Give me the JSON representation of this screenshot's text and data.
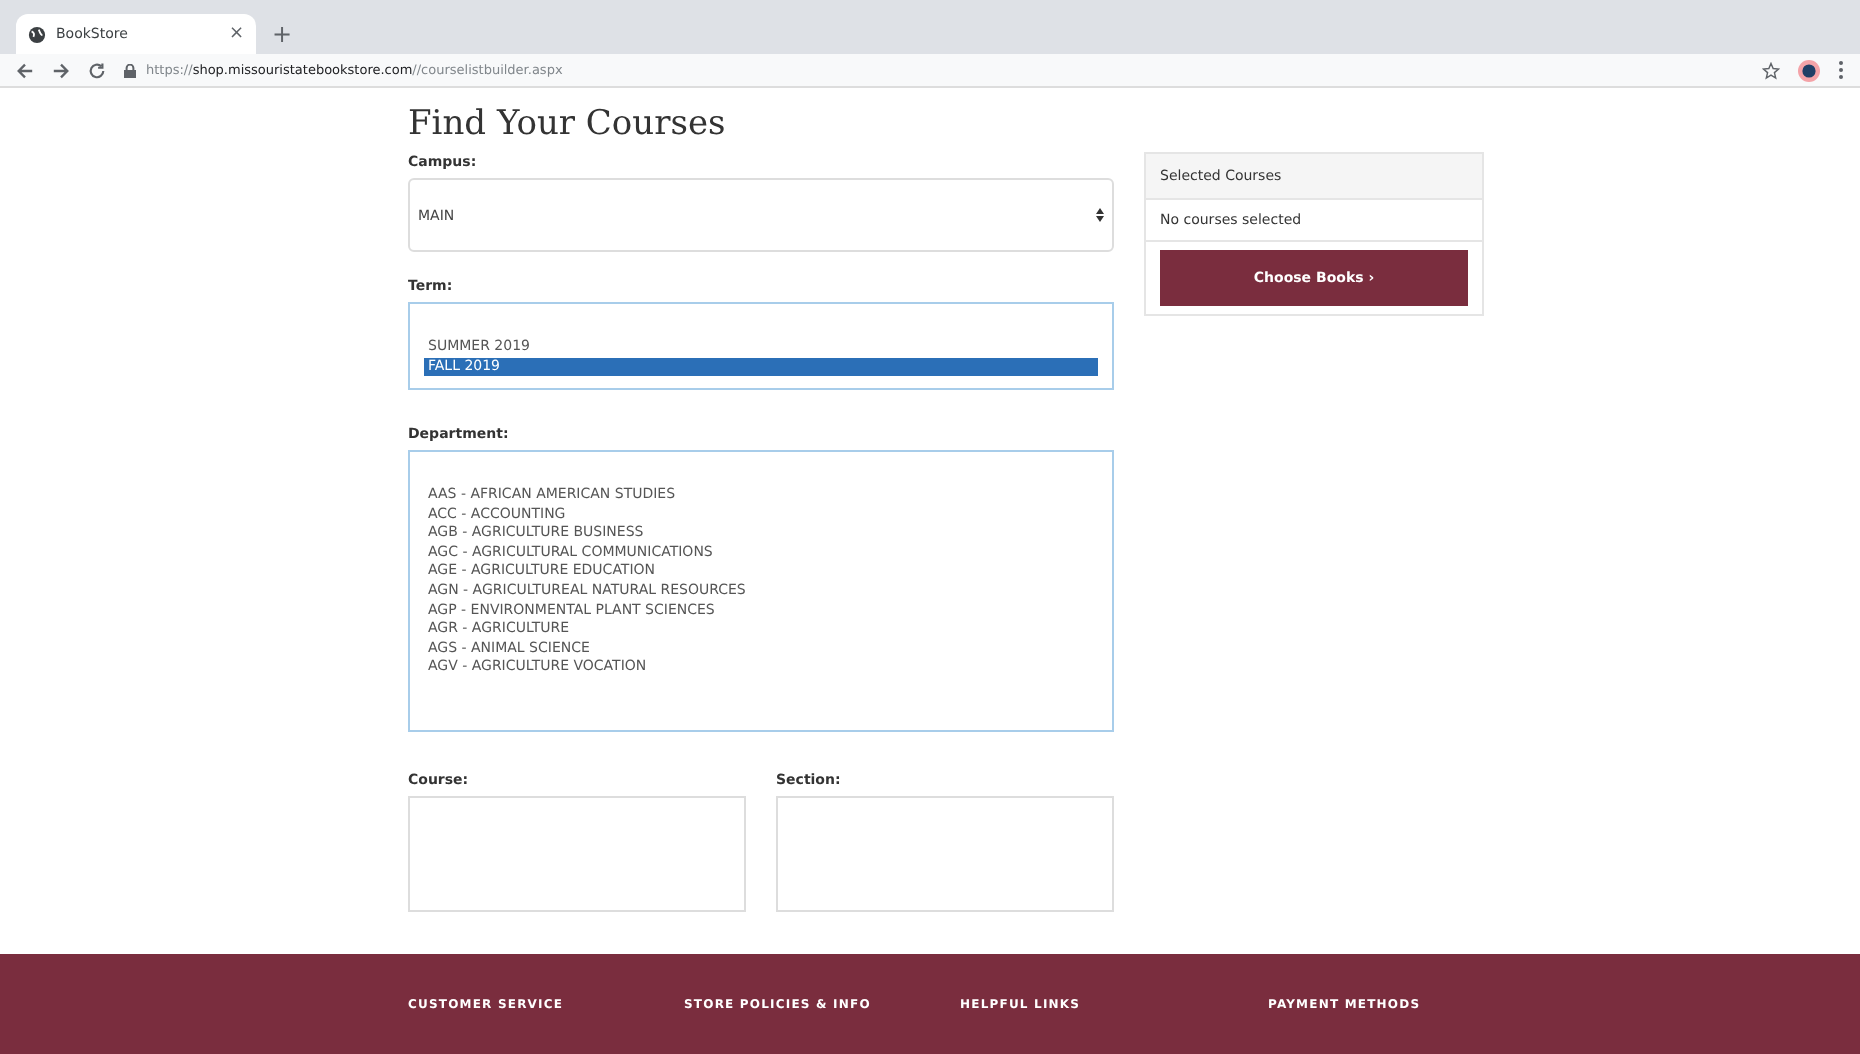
{
  "browser": {
    "tab_title": "BookStore",
    "tab_close": "×",
    "new_tab": "+",
    "url": "https://**shop.missouristatebookstore.com**//courselistbuilder.aspx"
  },
  "heading": "Find Your Courses",
  "campus": {
    "label": "Campus:",
    "value": "MAIN"
  },
  "term": {
    "label": "Term:",
    "options": [
      {
        "text": "SUMMER 2019",
        "selected": false
      },
      {
        "text": "FALL 2019",
        "selected": true
      }
    ]
  },
  "department": {
    "label": "Department:",
    "options": [
      {
        "text": "AAS - AFRICAN AMERICAN STUDIES",
        "selected": false
      },
      {
        "text": "ACC - ACCOUNTING",
        "selected": false
      },
      {
        "text": "AGB - AGRICULTURE BUSINESS",
        "selected": false
      },
      {
        "text": "AGC - AGRICULTURAL COMMUNICATIONS",
        "selected": false
      },
      {
        "text": "AGE - AGRICULTURE EDUCATION",
        "selected": false
      },
      {
        "text": "AGN - AGRICULTUREAL NATURAL RESOURCES",
        "selected": false
      },
      {
        "text": "AGP - ENVIRONMENTAL PLANT SCIENCES",
        "selected": false
      },
      {
        "text": "AGR - AGRICULTURE",
        "selected": false
      },
      {
        "text": "AGS - ANIMAL SCIENCE",
        "selected": false
      },
      {
        "text": "AGV - AGRICULTURE VOCATION",
        "selected": false
      }
    ]
  },
  "course": {
    "label": "Course:"
  },
  "section": {
    "label": "Section:"
  },
  "selected_courses": {
    "title": "Selected Courses",
    "empty_text": "No courses selected",
    "button": "Choose Books ›"
  },
  "footer": {
    "headings": [
      "CUSTOMER SERVICE",
      "STORE POLICIES & INFO",
      "HELPFUL LINKS",
      "PAYMENT METHODS"
    ]
  }
}
